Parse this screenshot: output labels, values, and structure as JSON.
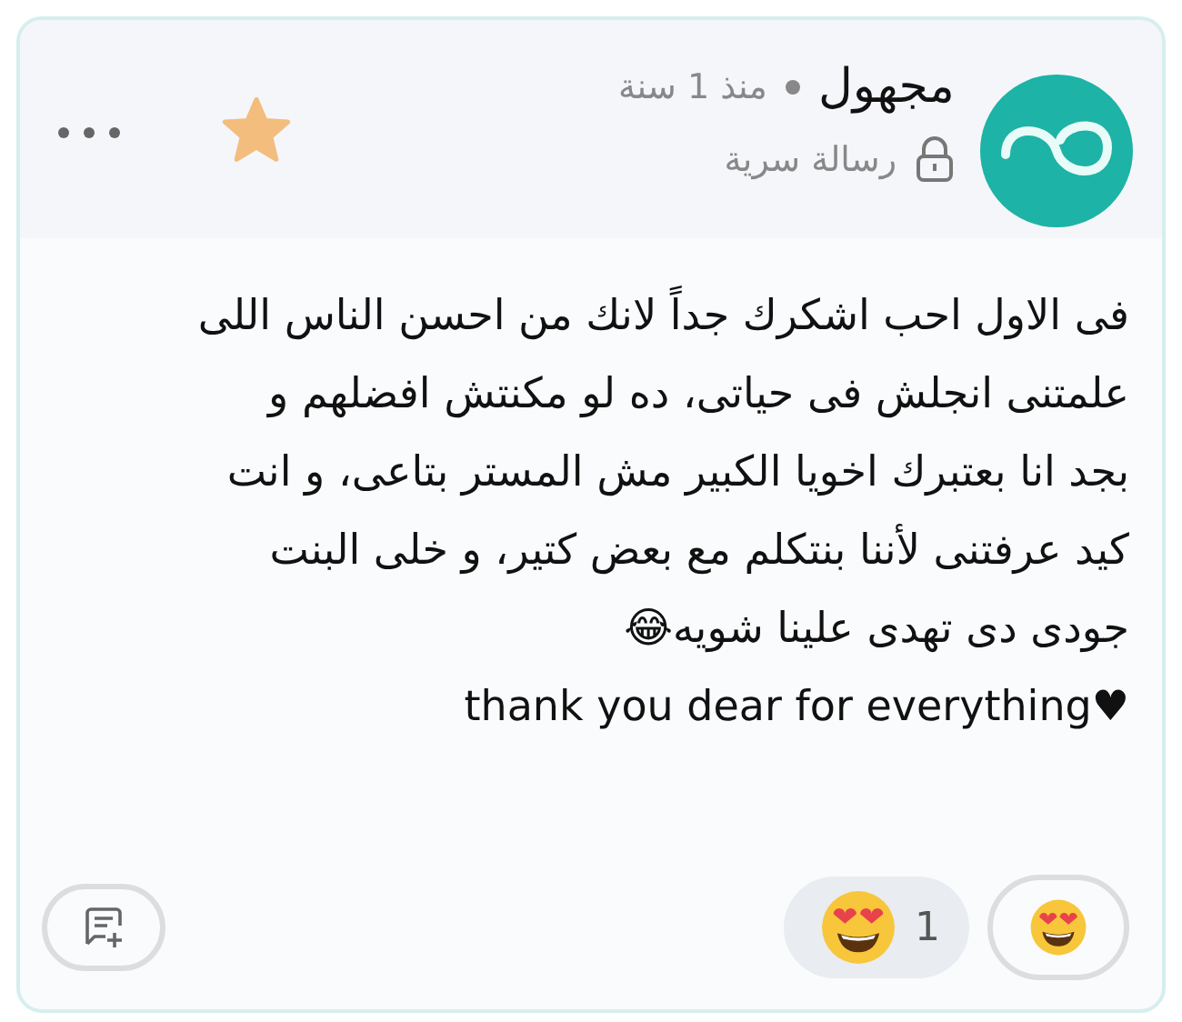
{
  "header": {
    "author": "مجهول",
    "time": "منذ 1 سنة",
    "privacy": "رسالة سرية",
    "starred": true
  },
  "message": "فى الاول احب اشكرك جداً لانك من احسن الناس اللى\nعلمتنى انجلش فى حياتى، ده لو مكنتش افضلهم و\nبجد انا بعتبرك اخويا الكبير مش المستر بتاعى، و انت\nكيد عرفتنى لأننا بنتكلم مع بعض كتير، و خلى البنت\nجودى دى تهدى علينا شويه😂\nthank you dear for everything♥",
  "reactions": [
    {
      "count": "1",
      "selected": true
    }
  ]
}
